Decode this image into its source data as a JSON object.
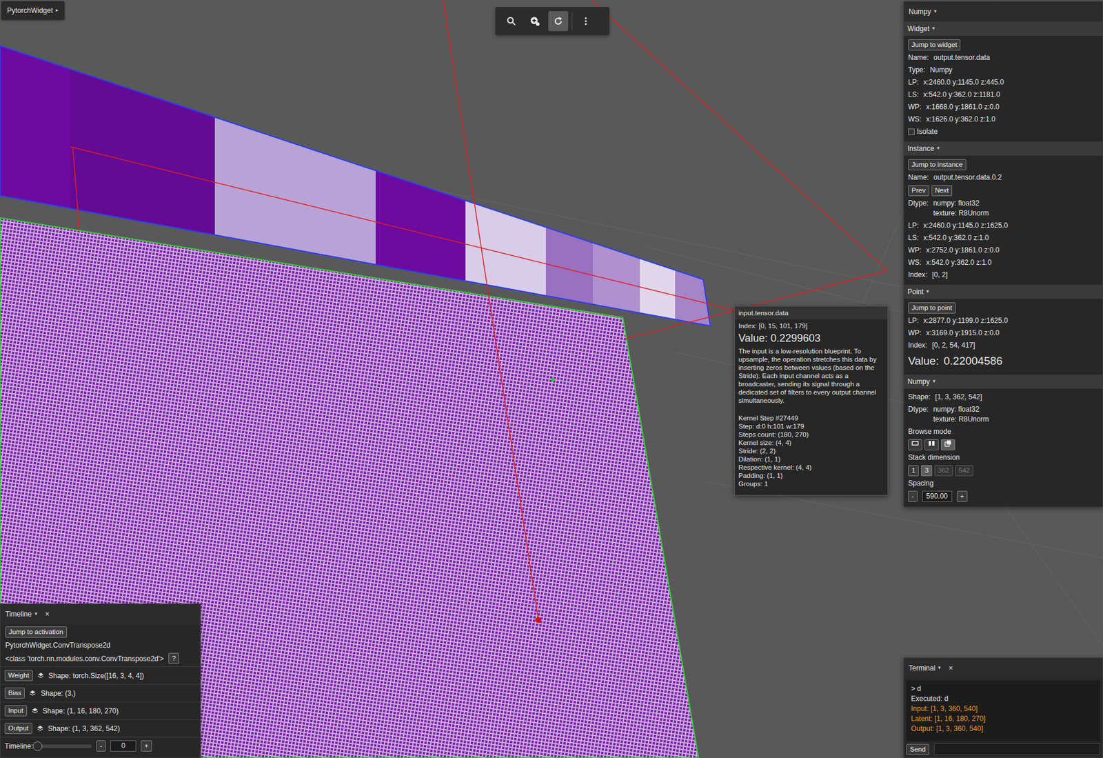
{
  "widget_menu": {
    "label": "PytorchWidget",
    "caret": "▸"
  },
  "toolbar": {
    "tools": [
      {
        "kind": "search",
        "selected": false
      },
      {
        "kind": "zoom",
        "selected": false
      },
      {
        "kind": "rotate",
        "selected": true
      },
      {
        "kind": "more",
        "selected": false
      }
    ]
  },
  "inspector": {
    "title": "Numpy",
    "caret": "▾",
    "widget": {
      "title": "Widget",
      "caret": "▾",
      "button": "Jump to widget",
      "fields": [
        {
          "label": "Name:",
          "value": "output.tensor.data"
        },
        {
          "label": "Type:",
          "value": "Numpy"
        },
        {
          "label": "LP:",
          "value": "x:2460.0 y:1145.0 z:445.0"
        },
        {
          "label": "LS:",
          "value": "x:542.0 y:362.0 z:1181.0"
        },
        {
          "label": "WP:",
          "value": "x:1668.0 y:1861.0 z:0.0"
        },
        {
          "label": "WS:",
          "value": "x:1626.0 y:362.0 z:1.0"
        }
      ],
      "isolate": {
        "label": "Isolate",
        "checked": false
      }
    },
    "instance": {
      "title": "Instance",
      "caret": "▾",
      "button": "Jump to instance",
      "fields_top": [
        {
          "label": "Name:",
          "value": "output.tensor.data.0.2"
        }
      ],
      "nav": [
        "Prev",
        "Next"
      ],
      "fields": [
        {
          "label": "Dtype:",
          "value": [
            "numpy: float32",
            "texture: R8Unorm"
          ]
        },
        {
          "label": "LP:",
          "value": "x:2460.0 y:1145.0 z:1625.0"
        },
        {
          "label": "LS:",
          "value": "x:542.0 y:362.0 z:1.0"
        },
        {
          "label": "WP:",
          "value": "x:2752.0 y:1861.0 z:0.0"
        },
        {
          "label": "WS:",
          "value": "x:542.0 y:362.0 z:1.0"
        },
        {
          "label": "Index:",
          "value": "[0, 2]"
        }
      ]
    },
    "point": {
      "title": "Point",
      "caret": "▾",
      "button": "Jump to point",
      "fields": [
        {
          "label": "LP:",
          "value": "x:2877.0 y:1199.0 z:1625.0"
        },
        {
          "label": "WP:",
          "value": "x:3169.0 y:1915.0 z:0.0"
        },
        {
          "label": "Index:",
          "value": "[0, 2, 54, 417]"
        }
      ],
      "value": {
        "label": "Value:",
        "number": "0.22004586"
      }
    },
    "numpy": {
      "title": "Numpy",
      "caret": "▾",
      "fields": [
        {
          "label": "Shape:",
          "value": "[1, 3, 362, 542]"
        },
        {
          "label": "Dtype:",
          "value": [
            "numpy: float32",
            "texture: R8Unorm"
          ]
        }
      ],
      "browse_mode": {
        "label": "Browse mode",
        "modes": [
          {
            "kind": "flat",
            "selected": false
          },
          {
            "kind": "stack",
            "selected": false
          },
          {
            "kind": "layers",
            "selected": true
          }
        ]
      },
      "stack_dimension": {
        "label": "Stack dimension",
        "options": [
          {
            "label": "1",
            "selected": false,
            "disabled": false
          },
          {
            "label": "3",
            "selected": true,
            "disabled": false
          },
          {
            "label": "362",
            "selected": false,
            "disabled": true
          },
          {
            "label": "542",
            "selected": false,
            "disabled": true
          }
        ]
      },
      "spacing": {
        "label": "Spacing",
        "minus": "-",
        "value": "590.00",
        "plus": "+"
      }
    }
  },
  "tooltip": {
    "title": "input.tensor.data",
    "index": "Index: [0, 15, 101, 179]",
    "value": "Value: 0.2299603",
    "description": "The input is a low-resolution blueprint. To upsample, the operation stretches this data by inserting zeros between values (based on the Stride). Each input channel acts as a broadcaster, sending its signal through a dedicated set of filters to every output channel simultaneously.",
    "kernel": [
      "Kernel Step #27449",
      "Step: d:0 h:101 w:179",
      "Steps count: (180, 270)",
      "Kernel size: (4, 4)",
      "Stride: (2, 2)",
      "Dilation: (1, 1)",
      "Respective kernel: (4, 4)",
      "Padding: (1, 1)",
      "Groups: 1"
    ]
  },
  "timeline": {
    "title": "Timeline",
    "caret": "▾",
    "close": "×",
    "button": "Jump to activation",
    "module": "PytorchWidget.ConvTranspose2d",
    "class_name": "<class 'torch.nn.modules.conv.ConvTranspose2d'>",
    "help": "?",
    "tensors": [
      {
        "label": "Weight",
        "shape": "Shape: torch.Size([16, 3, 4, 4])"
      },
      {
        "label": "Bias",
        "shape": "Shape: (3,)"
      },
      {
        "label": "Input",
        "shape": "Shape: (1, 16, 180, 270)"
      },
      {
        "label": "Output",
        "shape": "Shape: (1, 3, 362, 542)"
      }
    ],
    "slider": {
      "label": "Timeline:",
      "level": 0,
      "minus": "-",
      "value": "0",
      "plus": "+"
    }
  },
  "terminal": {
    "title": "Terminal",
    "caret": "▾",
    "close": "×",
    "lines": [
      {
        "text": "> d",
        "color": "#e6e6e6"
      },
      {
        "text": "Executed: d",
        "color": "#e6e6e6"
      },
      {
        "text": "Input: [1, 3, 360, 540]",
        "color": "#f0952e"
      },
      {
        "text": "Latent: [1, 16, 180, 270]",
        "color": "#f0952e"
      },
      {
        "text": "Output: [1, 3, 360, 540]",
        "color": "#f0952e"
      }
    ],
    "send": "Send"
  }
}
